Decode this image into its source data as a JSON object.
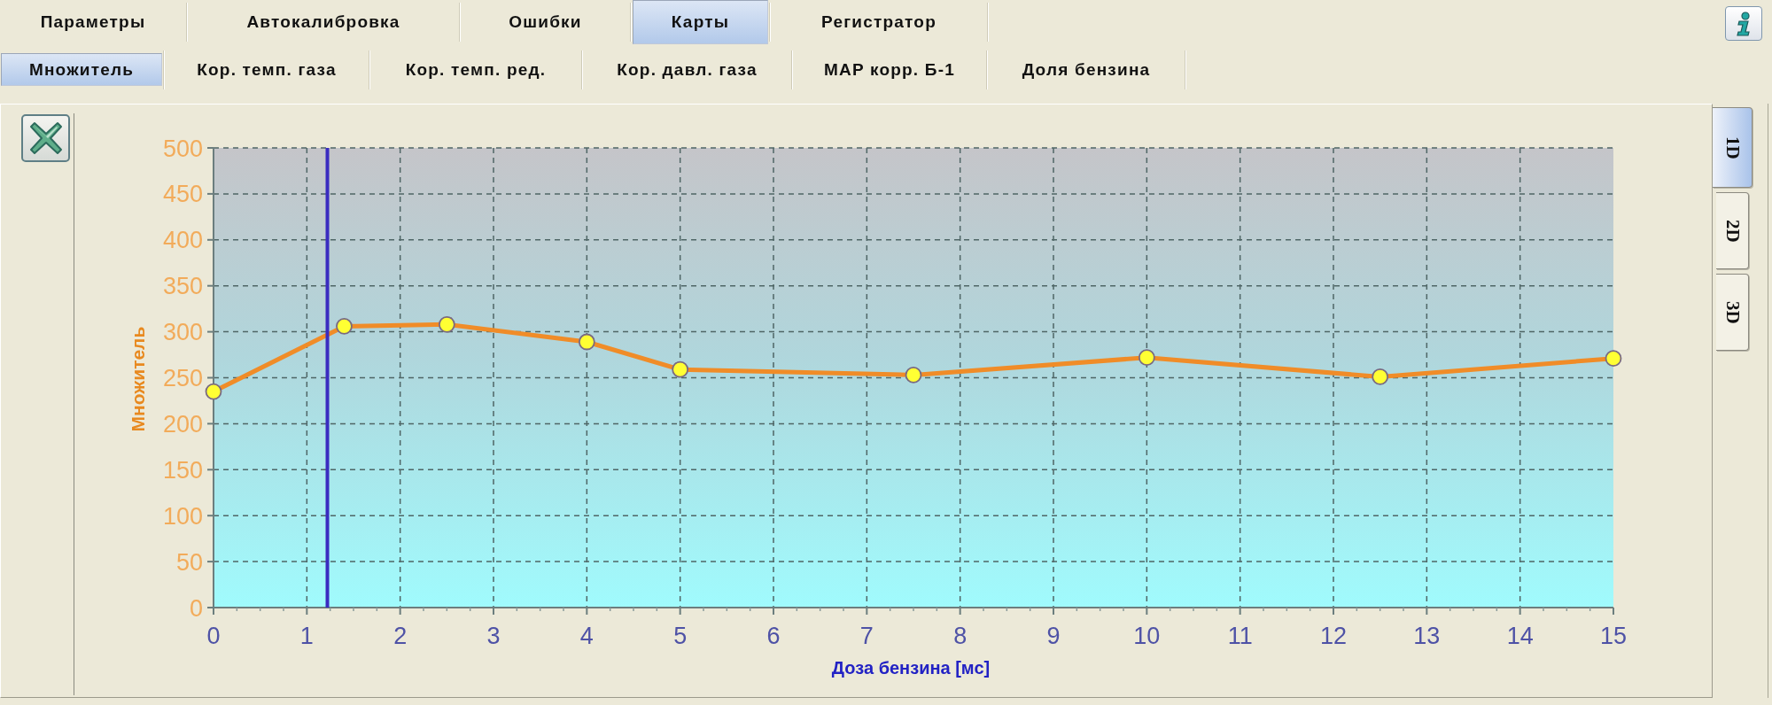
{
  "tabs": [
    {
      "label": "Параметры",
      "selected": false
    },
    {
      "label": "Автокалибровка",
      "selected": false
    },
    {
      "label": "Ошибки",
      "selected": false
    },
    {
      "label": "Карты",
      "selected": true
    },
    {
      "label": "Регистратор",
      "selected": false
    }
  ],
  "subtabs": [
    {
      "label": "Множитель",
      "selected": true
    },
    {
      "label": "Кор. темп. газа",
      "selected": false
    },
    {
      "label": "Кор. темп. ред.",
      "selected": false
    },
    {
      "label": "Кор. давл. газа",
      "selected": false
    },
    {
      "label": "MAP корр. Б-1",
      "selected": false
    },
    {
      "label": "Доля бензина",
      "selected": false
    }
  ],
  "chart": {
    "chart_data": {
      "type": "line",
      "xlabel": "Доза бензина [мс]",
      "ylabel": "Множитель",
      "x": [
        0,
        1.4,
        2.5,
        4,
        5,
        7.5,
        10,
        12.5,
        15
      ],
      "series": [
        {
          "color": "#f08c28",
          "marker": "circle",
          "values": [
            235,
            306,
            308,
            289,
            259,
            253,
            272,
            251,
            271
          ]
        }
      ],
      "xlim": [
        0,
        15
      ],
      "ylim": [
        0,
        500
      ],
      "xticks": [
        0,
        1,
        2,
        3,
        4,
        5,
        6,
        7,
        8,
        9,
        10,
        11,
        12,
        13,
        14,
        15
      ],
      "yticks": [
        0,
        50,
        100,
        150,
        200,
        250,
        300,
        350,
        400,
        450,
        500
      ],
      "grid": true,
      "ref_lines": [
        {
          "axis": "x",
          "value": 1.22,
          "color": "#3a2cc0"
        }
      ]
    }
  },
  "view_tabs": [
    {
      "label": "1D",
      "selected": true
    },
    {
      "label": "2D",
      "selected": false
    },
    {
      "label": "3D",
      "selected": false
    }
  ]
}
